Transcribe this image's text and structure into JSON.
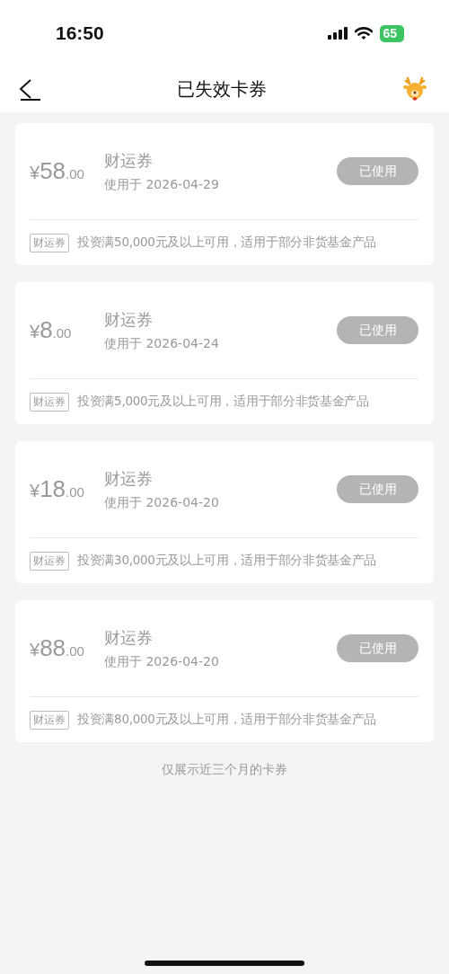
{
  "status_bar": {
    "time": "16:50",
    "battery": "65"
  },
  "nav": {
    "title": "已失效卡券"
  },
  "coupons": [
    {
      "currency": "¥",
      "amount": "58",
      "decimals": ".00",
      "name": "财运券",
      "used_on": "使用于 2026-04-29",
      "status": "已使用",
      "tag": "财运券",
      "condition": "投资满50,000元及以上可用，适用于部分非货基金产品"
    },
    {
      "currency": "¥",
      "amount": "8",
      "decimals": ".00",
      "name": "财运券",
      "used_on": "使用于 2026-04-24",
      "status": "已使用",
      "tag": "财运券",
      "condition": "投资满5,000元及以上可用，适用于部分非货基金产品"
    },
    {
      "currency": "¥",
      "amount": "18",
      "decimals": ".00",
      "name": "财运券",
      "used_on": "使用于 2026-04-20",
      "status": "已使用",
      "tag": "财运券",
      "condition": "投资满30,000元及以上可用，适用于部分非货基金产品"
    },
    {
      "currency": "¥",
      "amount": "88",
      "decimals": ".00",
      "name": "财运券",
      "used_on": "使用于 2026-04-20",
      "status": "已使用",
      "tag": "财运券",
      "condition": "投资满80,000元及以上可用，适用于部分非货基金产品"
    }
  ],
  "footer_note": "仅展示近三个月的卡券"
}
